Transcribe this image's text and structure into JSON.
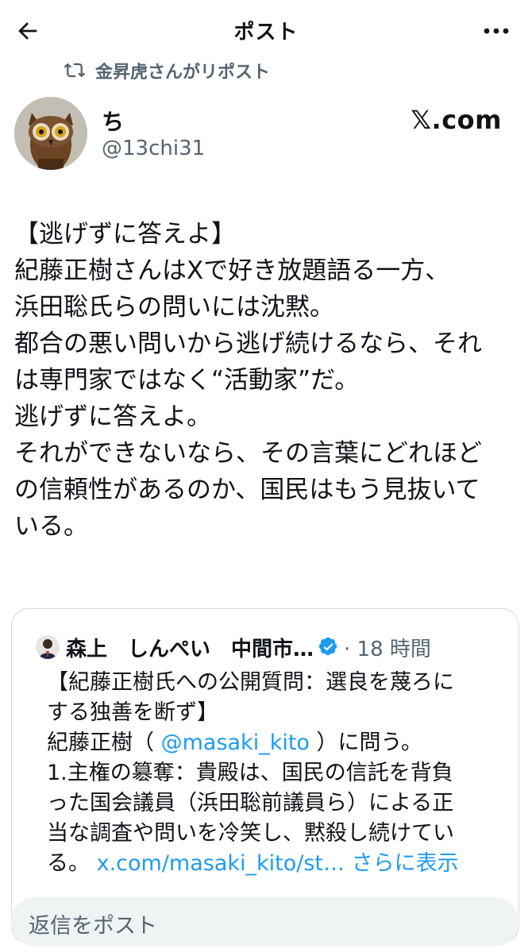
{
  "header": {
    "title": "ポスト"
  },
  "repost": {
    "text": "金昇虎さんがリポスト"
  },
  "author": {
    "name": "ち",
    "handle": "@13chi31",
    "source_logo": "𝕏.com"
  },
  "post": {
    "lines": [
      "【逃げずに答えよ】",
      "紀藤正樹さんはXで好き放題語る一方、",
      "浜田聡氏らの問いには沈黙。",
      "都合の悪い問いから逃げ続けるなら、それ",
      "は専門家ではなく“活動家”だ。",
      "逃げずに答えよ。",
      "それができないなら、その言葉にどれほど",
      "の信頼性があるのか、国民はもう見抜いて",
      "いる。"
    ]
  },
  "quote": {
    "name": "森上　しんぺい　中間市…",
    "time": "· 18 時間",
    "line1": "【紀藤正樹氏への公開質問：選良を蔑ろに",
    "line2": "する独善を断ず】",
    "line3_prefix": "紀藤正樹（",
    "line3_mention": "@masaki_kito",
    "line3_suffix": "）に問う。",
    "line4": "1.主権の簒奪：貴殿は、国民の信託を背負",
    "line5": "った国会議員（浜田聡前議員ら）による正",
    "line6": "当な調査や問いを冷笑し、黙殺し続けてい",
    "line7_prefix": "る。",
    "line7_link": "x.com/masaki_kito/st…",
    "line7_more": "さらに表示"
  },
  "reply": {
    "placeholder": "返信をポスト"
  },
  "colors": {
    "accent": "#1d9bf0",
    "muted": "#536471",
    "text": "#0f1419",
    "reply_bg": "#eff3f4"
  }
}
